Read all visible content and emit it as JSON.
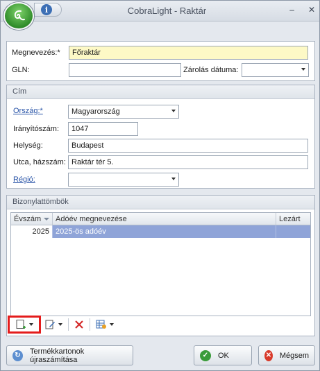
{
  "window": {
    "title": "CobraLight - Raktár",
    "minimize": "–",
    "close": "✕"
  },
  "general": {
    "name_label": "Megnevezés:*",
    "name_value": "Főraktár",
    "gln_label": "GLN:",
    "gln_value": "",
    "lock_date_label": "Zárolás dátuma:",
    "lock_date_value": ""
  },
  "address": {
    "header": "Cím",
    "country_label": "Ország:*",
    "country_value": "Magyarország",
    "zip_label": "Irányítószám:",
    "zip_value": "1047",
    "city_label": "Helység:",
    "city_value": "Budapest",
    "street_label": "Utca, házszám:",
    "street_value": "Raktár tér 5.",
    "region_label": "Régió:",
    "region_value": ""
  },
  "blocks": {
    "header": "Bizonylattömbök",
    "columns": [
      "Évszám",
      "Adóév megnevezése",
      "Lezárt"
    ],
    "rows": [
      {
        "year": "2025",
        "name": "2025-ös adóév",
        "closed": ""
      }
    ]
  },
  "buttons": {
    "recalc": "Termékkartonok újraszámítása",
    "ok": "OK",
    "cancel": "Mégsem"
  },
  "colors": {
    "selected_row": "#8fa4d8",
    "required_field": "#fdf9c6",
    "highlight_box": "#e41c1c"
  }
}
